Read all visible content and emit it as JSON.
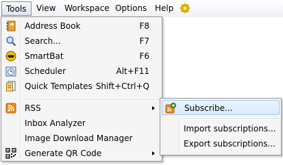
{
  "menubar": {
    "items": [
      {
        "label": "Tools"
      },
      {
        "label": "View"
      },
      {
        "label": "Workspace"
      },
      {
        "label": "Options"
      },
      {
        "label": "Help"
      }
    ],
    "extra_icon": "gear-icon"
  },
  "tools_menu": {
    "items": [
      {
        "label": "Address Book",
        "shortcut": "F8",
        "icon": "address-book-icon"
      },
      {
        "label": "Search...",
        "shortcut": "F7",
        "icon": "search-icon"
      },
      {
        "label": "SmartBat",
        "shortcut": "F6",
        "icon": "smartbat-icon"
      },
      {
        "label": "Scheduler",
        "shortcut": "Alt+F11",
        "icon": "scheduler-icon"
      },
      {
        "label": "Quick Templates",
        "shortcut": "Shift+Ctrl+Q",
        "icon": "quick-templates-icon"
      },
      {
        "label": "RSS",
        "shortcut": "",
        "icon": "rss-icon"
      },
      {
        "label": "Inbox Analyzer",
        "shortcut": ""
      },
      {
        "label": "Image Download Manager",
        "shortcut": ""
      },
      {
        "label": "Generate QR Code",
        "shortcut": "",
        "icon": "qr-code-icon"
      }
    ]
  },
  "rss_submenu": {
    "items": [
      {
        "label": "Subscribe...",
        "icon": "subscribe-icon"
      },
      {
        "label": "Import subscriptions..."
      },
      {
        "label": "Export subscriptions..."
      }
    ]
  },
  "colors": {
    "accent": "#a8c8ec",
    "highlight": "#d9ebfb",
    "menu_bg": "#f5f5f5"
  }
}
